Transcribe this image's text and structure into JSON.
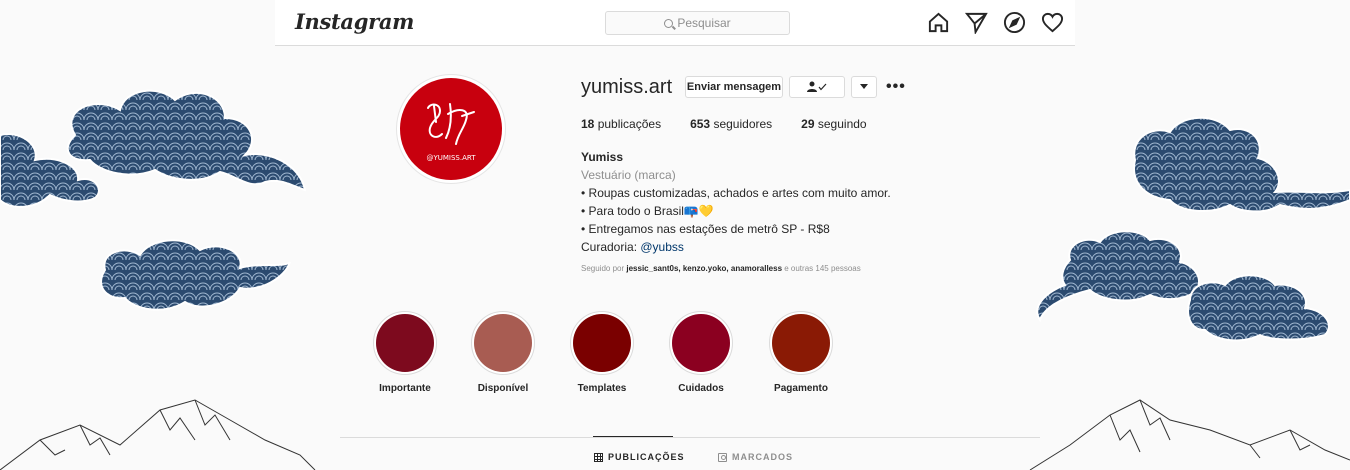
{
  "app": {
    "logo_text": "Instagram"
  },
  "search": {
    "placeholder": "Pesquisar"
  },
  "nav": {
    "icons": [
      "home-icon",
      "direct-icon",
      "explore-icon",
      "activity-heart-icon"
    ]
  },
  "profile": {
    "username": "yumiss.art",
    "avatar_text": "@YUMISS.ART",
    "buttons": {
      "message": "Enviar mensagem",
      "following_icon": "person-check-icon",
      "dropdown_icon": "chevron-down-icon",
      "more": "•••"
    },
    "stats": {
      "posts_count": "18",
      "posts_label": "publicações",
      "followers_count": "653",
      "followers_label": "seguidores",
      "following_count": "29",
      "following_label": "seguindo"
    },
    "bio": {
      "name": "Yumiss",
      "category": "Vestuário (marca)",
      "line1": "• Roupas customizadas, achados e artes com muito amor.",
      "line2": "• Para todo o Brasil📪💛",
      "line3": "• Entregamos nas estações de metrô SP - R$8",
      "curadoria_label": "Curadoria: ",
      "curadoria_link": "@yubss"
    },
    "followed_by": {
      "prefix": "Seguido por ",
      "users": "jessic_sant0s, kenzo.yoko, anamoralless",
      "suffix": " e outras 145 pessoas"
    }
  },
  "highlights": [
    {
      "label": "Importante",
      "color": "#7d0a1e"
    },
    {
      "label": "Disponível",
      "color": "#a85c52"
    },
    {
      "label": "Templates",
      "color": "#7a0000"
    },
    {
      "label": "Cuidados",
      "color": "#8b0020"
    },
    {
      "label": "Pagamento",
      "color": "#8a1a05"
    }
  ],
  "tabs": {
    "posts": "PUBLICAÇÕES",
    "tagged": "MARCADOS"
  },
  "colors": {
    "cloud": "#2b4a6f",
    "avatar_bg": "#c8000e"
  }
}
